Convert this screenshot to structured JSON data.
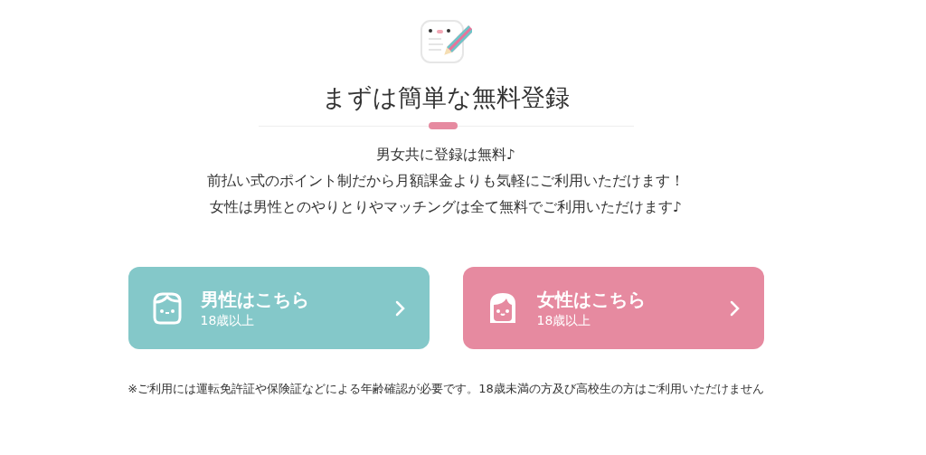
{
  "title": "まずは簡単な無料登録",
  "description": [
    "男女共に登録は無料♪",
    "前払い式のポイント制だから月額課金よりも気軽にご利用いただけます！",
    "女性は男性とのやりとりやマッチングは全て無料でご利用いただけます♪"
  ],
  "buttons": [
    {
      "kind": "male",
      "label": "男性はこちら",
      "sublabel": "18歳以上",
      "color": "#84c8c9"
    },
    {
      "kind": "female",
      "label": "女性はこちら",
      "sublabel": "18歳以上",
      "color": "#e68aa0"
    }
  ],
  "note": "※ご利用には運転免許証や保険証などによる年齢確認が必要です。18歳未満の方及び高校生の方はご利用いただけません"
}
